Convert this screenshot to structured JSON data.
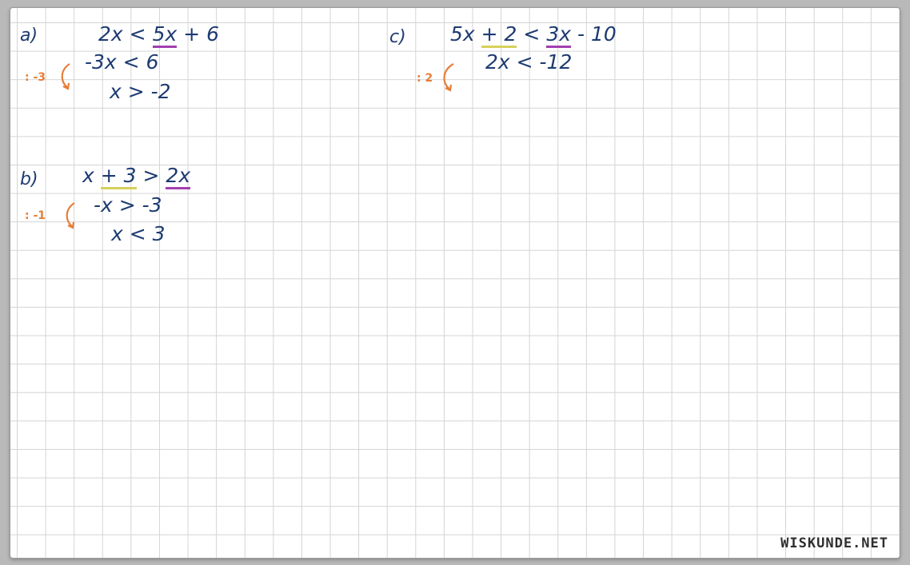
{
  "problem_a": {
    "label": "a)",
    "line1": {
      "left": "2x",
      "op": "<",
      "rhs_term": "5x",
      "rhs_rest": "+ 6"
    },
    "line2": "-3x < 6",
    "line3": "x > -2",
    "note": ": -3"
  },
  "problem_b": {
    "label": "b)",
    "line1": {
      "lhs_x": "x",
      "lhs_term": "+ 3",
      "op": ">",
      "rhs_term": "2x"
    },
    "line2": "-x > -3",
    "line3": "x < 3",
    "note": ": -1"
  },
  "problem_c": {
    "label": "c)",
    "line1": {
      "lhs_x": "5x",
      "lhs_term": "+ 2",
      "op": "<",
      "rhs_term": "3x",
      "rhs_rest": "- 10"
    },
    "line2": "2x < -12",
    "note": ": 2"
  },
  "watermark": "WISKUNDE.NET",
  "colors": {
    "ink": "#1d3b72",
    "annotation": "#e67e3a",
    "underline_purple": "#a23fb0",
    "underline_yellow": "#d6d15a",
    "grid": "#d4d4d4"
  }
}
